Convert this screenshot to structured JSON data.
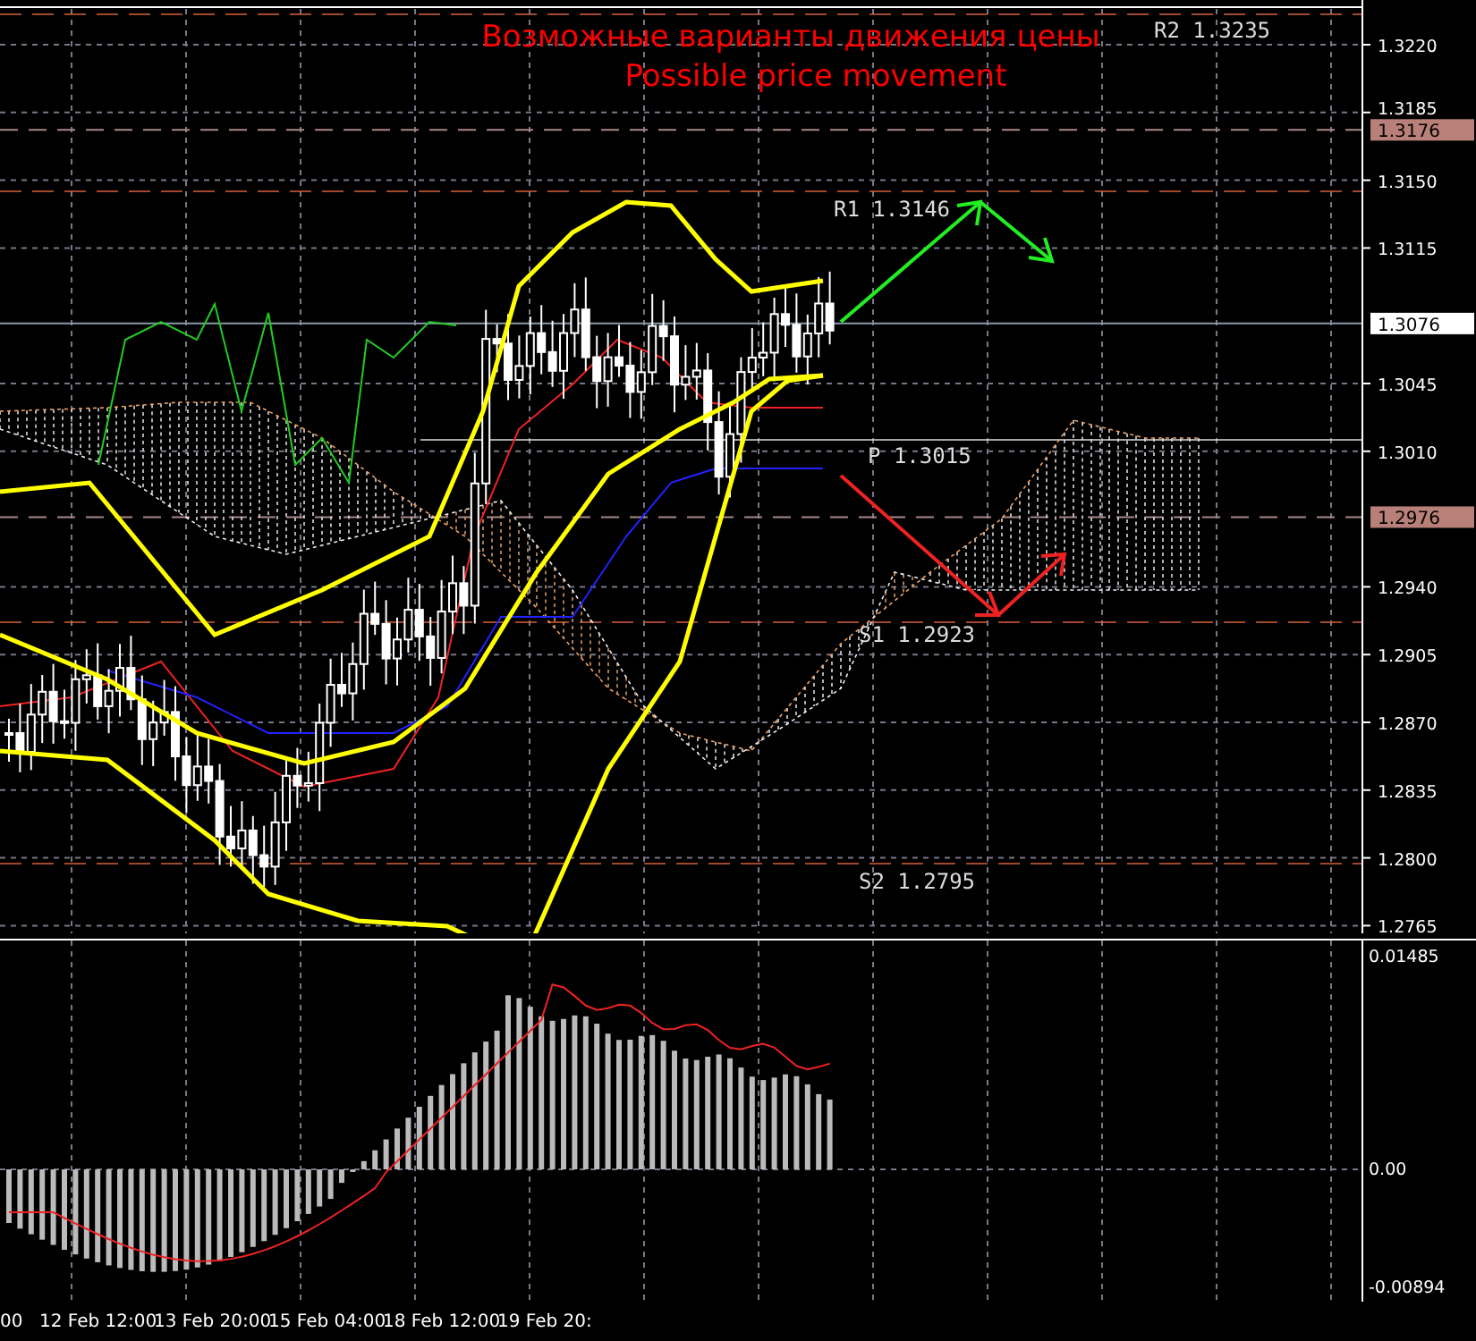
{
  "title": {
    "lines": [
      "Возможные варианты движения цены",
      "Possible price movement"
    ]
  },
  "levels": [
    {
      "label": "R2 1.3235"
    },
    {
      "label": "R1 1.3146"
    },
    {
      "label": "P 1.3015"
    },
    {
      "label": "S1 1.2923"
    },
    {
      "label": "S2 1.2795"
    }
  ],
  "price_axis": {
    "ticks": [
      "1.3220",
      "1.3185",
      "1.3150",
      "1.3115",
      "1.3045",
      "1.3010",
      "1.2940",
      "1.2905",
      "1.2870",
      "1.2835",
      "1.2800",
      "1.2765"
    ],
    "tags": [
      {
        "value": "1.3176",
        "kind": "level"
      },
      {
        "value": "1.3076",
        "kind": "current"
      },
      {
        "value": "1.2976",
        "kind": "level"
      }
    ]
  },
  "oscillator_axis": {
    "ticks": [
      "0.01485",
      "0.00",
      "-0.00894"
    ]
  },
  "time_axis": {
    "labels": [
      "00",
      "12 Feb 12:00",
      "13 Feb 20:00",
      "15 Feb 04:00",
      "18 Feb 12:00",
      "19 Feb 20:"
    ]
  }
}
